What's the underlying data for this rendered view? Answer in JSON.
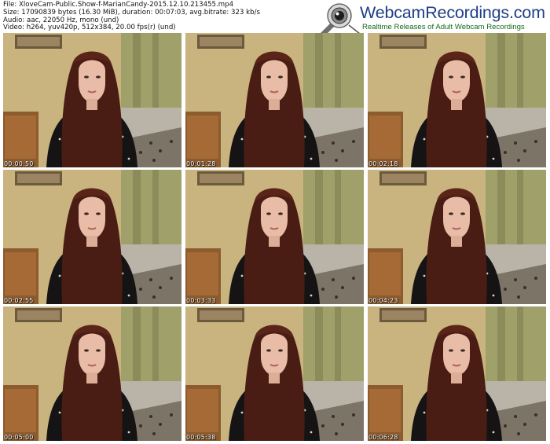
{
  "meta": {
    "file": "File: XloveCam-Public.Show-f-MarianCandy-2015.12.10.213455.mp4",
    "size": "Size: 17090839 bytes (16.30 MiB), duration: 00:07:03, avg.bitrate: 323 kb/s",
    "audio": "Audio: aac, 22050 Hz, mono (und)",
    "video": "Video: h264, yuv420p, 512x384, 20.00 fps(r) (und)"
  },
  "logo": {
    "title": "WebcamRecordings.com",
    "tagline": "Realtime Releases of Adult Webcam Recordings",
    "icon": "webcam-icon",
    "title_color": "#1f3f86",
    "tagline_color": "#0f6b1a"
  },
  "thumbnails": [
    {
      "timestamp": "00:00:50"
    },
    {
      "timestamp": "00:01:28"
    },
    {
      "timestamp": "00:02:18"
    },
    {
      "timestamp": "00:02:55"
    },
    {
      "timestamp": "00:03:33"
    },
    {
      "timestamp": "00:04:23"
    },
    {
      "timestamp": "00:05:00"
    },
    {
      "timestamp": "00:05:38"
    },
    {
      "timestamp": "00:06:28"
    }
  ]
}
